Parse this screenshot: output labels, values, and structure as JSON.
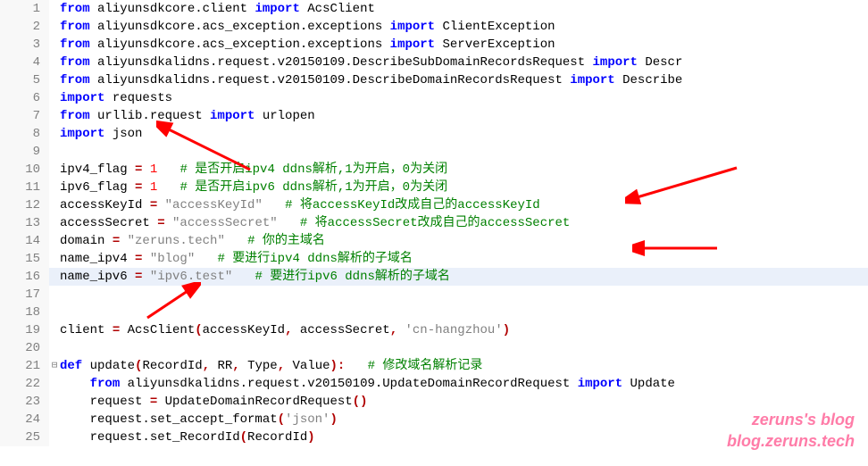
{
  "lines": {
    "l1": [
      "kw:from",
      "ident: aliyunsdkcore.client ",
      "kw:import",
      "ident: AcsClient"
    ],
    "l2": [
      "kw:from",
      "ident: aliyunsdkcore.acs_exception.exceptions ",
      "kw:import",
      "ident: ClientException"
    ],
    "l3": [
      "kw:from",
      "ident: aliyunsdkcore.acs_exception.exceptions ",
      "kw:import",
      "ident: ServerException"
    ],
    "l4": [
      "kw:from",
      "ident: aliyunsdkalidns.request.v20150109.DescribeSubDomainRecordsRequest ",
      "kw:import",
      "ident: Descr"
    ],
    "l5": [
      "kw:from",
      "ident: aliyunsdkalidns.request.v20150109.DescribeDomainRecordsRequest ",
      "kw:import",
      "ident: Describe"
    ],
    "l6": [
      "kw:import",
      "ident: requests"
    ],
    "l7": [
      "kw:from",
      "ident: urllib.request ",
      "kw:import",
      "ident: urlopen"
    ],
    "l8": [
      "kw:import",
      "ident: json"
    ],
    "l9": [],
    "l10": [
      "ident:ipv4_flag ",
      "op:=",
      "ident: ",
      "num:1",
      "ident:   ",
      "cmt:# 是否开启ipv4 ddns解析,1为开启，0为关闭"
    ],
    "l11": [
      "ident:ipv6_flag ",
      "op:=",
      "ident: ",
      "num:1",
      "ident:   ",
      "cmt:# 是否开启ipv6 ddns解析,1为开启，0为关闭"
    ],
    "l12": [
      "ident:accessKeyId ",
      "op:=",
      "ident: ",
      "str:\"accessKeyId\"",
      "ident:   ",
      "cmt:# 将accessKeyId改成自己的accessKeyId"
    ],
    "l13": [
      "ident:accessSecret ",
      "op:=",
      "ident: ",
      "str:\"accessSecret\"",
      "ident:   ",
      "cmt:# 将accessSecret改成自己的accessSecret"
    ],
    "l14": [
      "ident:domain ",
      "op:=",
      "ident: ",
      "str:\"zeruns.tech\"",
      "ident:   ",
      "cmt:# 你的主域名"
    ],
    "l15": [
      "ident:name_ipv4 ",
      "op:=",
      "ident: ",
      "str:\"blog\"",
      "ident:   ",
      "cmt:# 要进行ipv4 ddns解析的子域名"
    ],
    "l16": [
      "ident:name_ipv6 ",
      "op:=",
      "ident: ",
      "str:\"ipv6.test\"",
      "ident:   ",
      "cmt:# 要进行ipv6 ddns解析的子域名"
    ],
    "l17": [],
    "l18": [],
    "l19": [
      "ident:client ",
      "op:=",
      "ident: AcsClient",
      "op:(",
      "ident:accessKeyId",
      "op:,",
      "ident: accessSecret",
      "op:,",
      "ident: ",
      "str:'cn-hangzhou'",
      "op:)"
    ],
    "l20": [],
    "l21": [
      "kw:def",
      "ident: update",
      "op:(",
      "ident:RecordId",
      "op:,",
      "ident: RR",
      "op:,",
      "ident: Type",
      "op:,",
      "ident: Value",
      "op:):",
      "ident:   ",
      "cmt:# 修改域名解析记录"
    ],
    "l22": [
      "ident:    ",
      "kw:from",
      "ident: aliyunsdkalidns.request.v20150109.UpdateDomainRecordRequest ",
      "kw:import",
      "ident: Update"
    ],
    "l23": [
      "ident:    request ",
      "op:=",
      "ident: UpdateDomainRecordRequest",
      "op:()"
    ],
    "l24": [
      "ident:    request.set_accept_format",
      "op:(",
      "str:'json'",
      "op:)"
    ],
    "l25": [
      "ident:    request.set_RecordId",
      "op:(",
      "ident:RecordId",
      "op:)"
    ]
  },
  "fold": {
    "l21": "⊟"
  },
  "highlight_line": 16,
  "watermark": {
    "line1": "zeruns's blog",
    "line2": "blog.zeruns.tech"
  }
}
